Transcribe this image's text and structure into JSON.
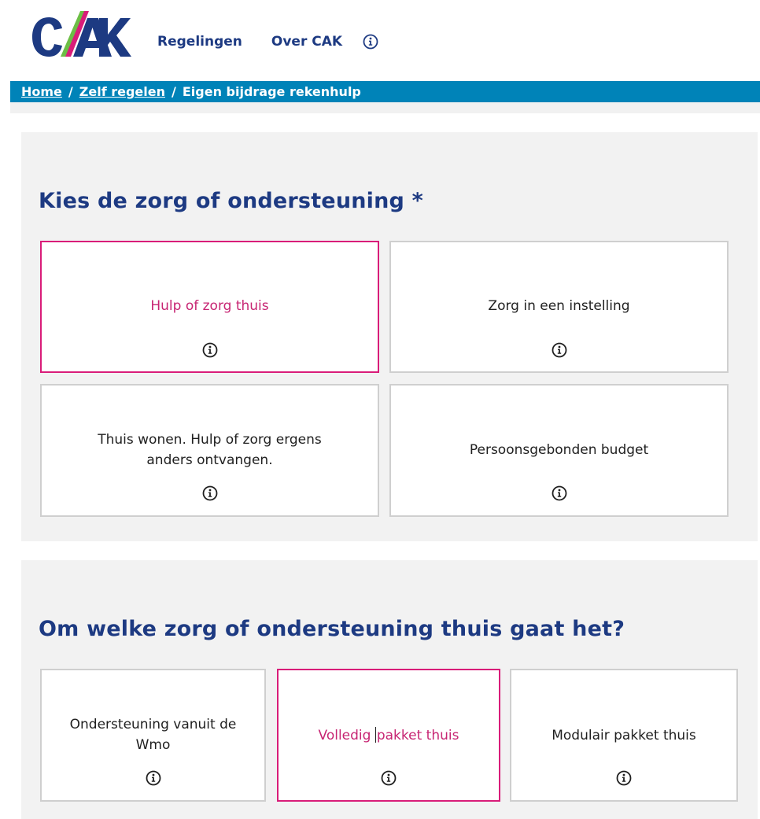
{
  "brand": {
    "logo_text": "CAK",
    "colors": {
      "navy": "#1d3a82",
      "pink": "#d91c79",
      "blue": "#0083b8",
      "green": "#6cbe45"
    }
  },
  "nav": {
    "items": [
      {
        "label": "Regelingen"
      },
      {
        "label": "Over CAK"
      }
    ],
    "info_icon": "info-icon"
  },
  "breadcrumb": {
    "home": "Home",
    "sep": "/",
    "zelf_regelen": "Zelf regelen",
    "current": "Eigen bijdrage rekenhulp"
  },
  "section1": {
    "title": "Kies de zorg of ondersteuning *",
    "options": [
      {
        "label": "Hulp of zorg thuis",
        "selected": true
      },
      {
        "label": "Zorg in een instelling",
        "selected": false
      },
      {
        "label_line1": "Thuis wonen. Hulp of zorg ergens",
        "label_line2": "anders ontvangen.",
        "selected": false
      },
      {
        "label": "Persoonsgebonden budget",
        "selected": false
      }
    ]
  },
  "section2": {
    "title": "Om welke zorg of ondersteuning thuis gaat het?",
    "options": [
      {
        "label_line1": "Ondersteuning vanuit de",
        "label_line2": "Wmo",
        "selected": false
      },
      {
        "label_part1": "Volledig ",
        "label_part2": "pakket thuis",
        "selected": true
      },
      {
        "label": "Modulair pakket thuis",
        "selected": false
      }
    ]
  }
}
